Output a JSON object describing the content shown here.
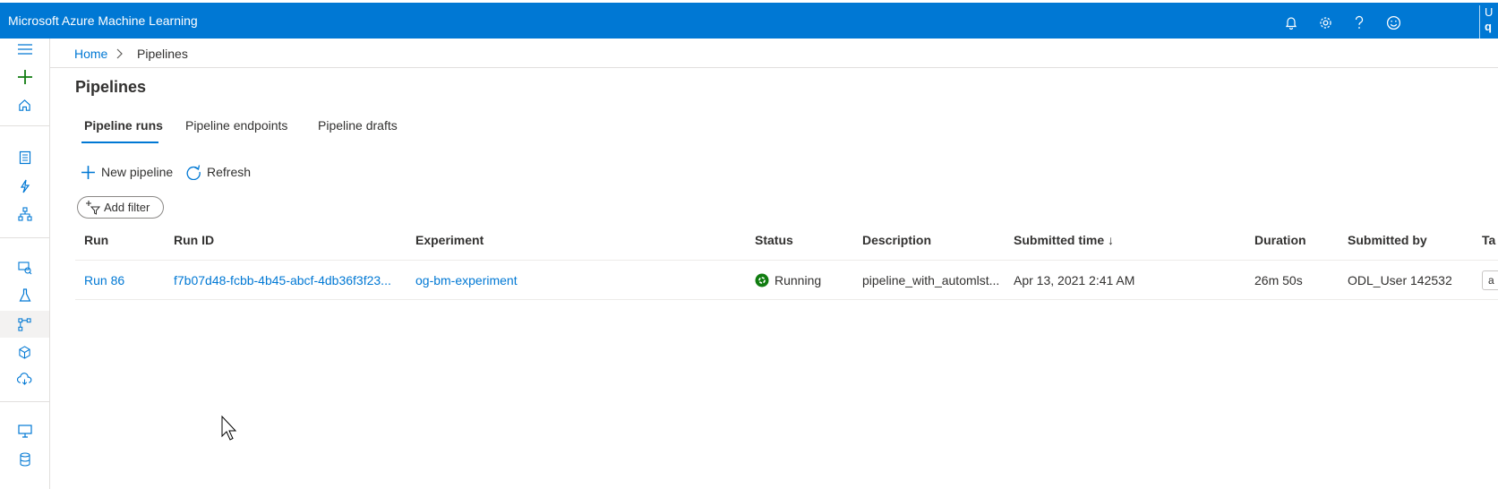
{
  "app": {
    "title": "Microsoft Azure Machine Learning"
  },
  "header": {
    "icons": [
      "bell-icon",
      "settings-gear-icon",
      "help-question-icon",
      "feedback-smiley-icon"
    ],
    "user_line1": "U",
    "user_line2": "q"
  },
  "colors": {
    "brand_blue": "#0078d4",
    "status_running_green": "#107c10",
    "link_blue": "#0078d4"
  },
  "breadcrumb": {
    "home": "Home",
    "current": "Pipelines"
  },
  "page": {
    "title": "Pipelines"
  },
  "tabs": [
    {
      "label": "Pipeline runs",
      "active": true
    },
    {
      "label": "Pipeline endpoints",
      "active": false
    },
    {
      "label": "Pipeline drafts",
      "active": false
    }
  ],
  "commands": {
    "new_pipeline": "New pipeline",
    "refresh": "Refresh"
  },
  "filter": {
    "add_filter": "Add filter"
  },
  "table": {
    "columns": {
      "run": "Run",
      "run_id": "Run ID",
      "experiment": "Experiment",
      "status": "Status",
      "description": "Description",
      "submitted_time": "Submitted time ↓",
      "duration": "Duration",
      "submitted_by": "Submitted by",
      "tags": "Ta"
    },
    "rows": [
      {
        "run": "Run 86",
        "run_id": "f7b07d48-fcbb-4b45-abcf-4db36f3f23...",
        "experiment": "og-bm-experiment",
        "status": "Running",
        "description": "pipeline_with_automlst...",
        "submitted_time": "Apr 13, 2021 2:41 AM",
        "duration": "26m 50s",
        "submitted_by": "ODL_User 142532",
        "tags": "a"
      }
    ]
  },
  "sidebar": {
    "items": [
      {
        "icon": "hamburger-menu-icon"
      },
      {
        "icon": "plus-create-icon"
      },
      {
        "icon": "home-icon"
      },
      {
        "icon": "notebooks-icon"
      },
      {
        "icon": "automated-ml-icon"
      },
      {
        "icon": "designer-icon"
      },
      {
        "icon": "datasets-icon"
      },
      {
        "icon": "experiments-icon"
      },
      {
        "icon": "pipelines-icon",
        "active": true
      },
      {
        "icon": "models-icon"
      },
      {
        "icon": "endpoints-icon"
      },
      {
        "icon": "compute-icon"
      },
      {
        "icon": "datastores-icon"
      }
    ]
  }
}
